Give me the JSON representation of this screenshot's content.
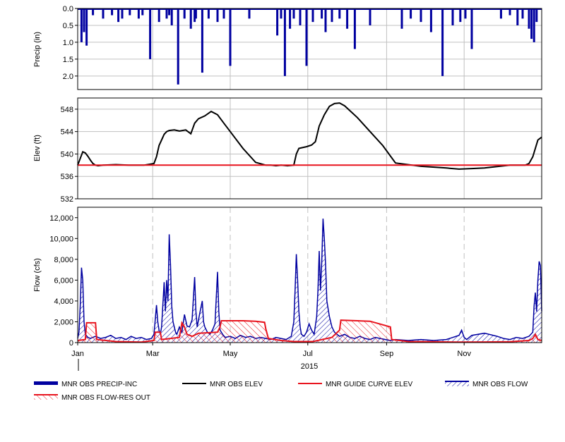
{
  "colors": {
    "precip": "#0000a0",
    "elev": "#000000",
    "guide": "#e8141e",
    "flow": "#0000a0",
    "release": "#e8141e",
    "grid": "#c0c0c0",
    "frame": "#000000"
  },
  "chart_data": [
    {
      "type": "bar",
      "ylabel": "Precip (in)",
      "ylim": [
        0,
        2.4
      ],
      "inverted_y": true,
      "grid": true,
      "y_ticks": [
        "0.0",
        "0.5",
        "1.0",
        "1.5",
        "2.0"
      ],
      "x_day_range": [
        0,
        365
      ],
      "series": [
        {
          "name": "MNR OBS PRECIP-INC",
          "color": "#0000a0",
          "day": [
            3,
            5,
            7,
            12,
            20,
            27,
            32,
            35,
            41,
            48,
            51,
            57,
            64,
            70,
            72,
            74,
            79,
            84,
            89,
            92,
            93,
            98,
            103,
            110,
            115,
            120,
            135,
            157,
            160,
            163,
            167,
            170,
            175,
            180,
            185,
            192,
            195,
            200,
            206,
            212,
            218,
            230,
            255,
            262,
            270,
            278,
            287,
            295,
            301,
            305,
            310,
            333,
            340,
            346,
            350,
            355,
            357,
            359,
            361
          ],
          "value": [
            1.0,
            0.7,
            1.1,
            0.2,
            0.3,
            0.2,
            0.4,
            0.3,
            0.2,
            0.3,
            0.2,
            1.5,
            0.4,
            0.3,
            0.2,
            0.5,
            2.25,
            0.3,
            0.6,
            0.4,
            0.3,
            1.9,
            0.3,
            0.4,
            0.3,
            1.7,
            0.3,
            0.8,
            0.3,
            2.0,
            0.6,
            0.3,
            0.5,
            1.7,
            0.4,
            0.3,
            0.7,
            0.4,
            0.3,
            0.6,
            1.2,
            0.5,
            0.6,
            0.3,
            0.4,
            0.7,
            2.0,
            0.5,
            0.4,
            0.3,
            1.2,
            0.3,
            0.2,
            0.5,
            0.3,
            0.6,
            0.9,
            1.0,
            0.4
          ]
        }
      ]
    },
    {
      "type": "line",
      "ylabel": "Elev (ft)",
      "ylim": [
        532,
        550
      ],
      "grid": true,
      "y_ticks": [
        "532",
        "536",
        "540",
        "544",
        "548"
      ],
      "y_tick_values": [
        532,
        536,
        540,
        544,
        548
      ],
      "x_day_range": [
        0,
        365
      ],
      "series": [
        {
          "name": "MNR OBS ELEV",
          "color": "#000000",
          "day": [
            0,
            2,
            4,
            6,
            8,
            10,
            12,
            14,
            16,
            20,
            30,
            40,
            52,
            60,
            62,
            64,
            66,
            68,
            70,
            72,
            76,
            80,
            85,
            89,
            92,
            95,
            100,
            105,
            110,
            115,
            120,
            130,
            140,
            148,
            152,
            156,
            160,
            165,
            170,
            172,
            174,
            178,
            180,
            184,
            187,
            190,
            194,
            198,
            202,
            206,
            210,
            220,
            230,
            240,
            250,
            270,
            290,
            300,
            310,
            320,
            340,
            352,
            355,
            358,
            360,
            362,
            365
          ],
          "value": [
            538.0,
            539.2,
            540.4,
            540.2,
            539.6,
            538.9,
            538.3,
            538.0,
            537.9,
            538.0,
            538.1,
            538.0,
            538.0,
            538.3,
            539.5,
            541.5,
            542.5,
            543.5,
            544.0,
            544.2,
            544.3,
            544.1,
            544.3,
            543.6,
            545.5,
            546.3,
            546.8,
            547.6,
            547.0,
            545.5,
            544.0,
            541.0,
            538.5,
            538.0,
            538.0,
            537.9,
            538.0,
            537.9,
            538.0,
            540.0,
            541.0,
            541.2,
            541.3,
            541.6,
            542.2,
            545.0,
            547.0,
            548.5,
            549.0,
            549.1,
            548.6,
            546.5,
            544.0,
            541.5,
            538.4,
            537.8,
            537.5,
            537.3,
            537.4,
            537.5,
            538.0,
            538.0,
            538.3,
            539.5,
            541.0,
            542.5,
            543.0
          ]
        },
        {
          "name": "MNR GUIDE CURVE ELEV",
          "color": "#e8141e",
          "day": [
            0,
            365
          ],
          "value": [
            538.0,
            538.0
          ]
        }
      ]
    },
    {
      "type": "area",
      "ylabel": "Flow (cfs)",
      "xlabel": "2015",
      "ylim": [
        0,
        13000
      ],
      "grid": true,
      "y_ticks": [
        "0",
        "2,000",
        "4,000",
        "6,000",
        "8,000",
        "10,000",
        "12,000"
      ],
      "y_tick_values": [
        0,
        2000,
        4000,
        6000,
        8000,
        10000,
        12000
      ],
      "x_ticks": [
        "Jan",
        "Mar",
        "May",
        "Jul",
        "Sep",
        "Nov"
      ],
      "x_tick_days": [
        0,
        59,
        120,
        181,
        243,
        304
      ],
      "x_day_range": [
        0,
        365
      ],
      "series": [
        {
          "name": "MNR OBS FLOW",
          "color": "#0000a0",
          "hatched": true,
          "day": [
            0,
            1,
            2,
            3,
            4,
            5,
            6,
            8,
            10,
            14,
            18,
            22,
            26,
            30,
            34,
            38,
            42,
            46,
            50,
            54,
            58,
            60,
            62,
            63,
            64,
            65,
            66,
            68,
            69,
            70,
            71,
            72,
            73,
            74,
            75,
            76,
            77,
            78,
            80,
            82,
            84,
            86,
            88,
            90,
            92,
            93,
            94,
            96,
            98,
            99,
            100,
            102,
            104,
            106,
            108,
            110,
            111,
            112,
            114,
            116,
            120,
            124,
            128,
            132,
            136,
            140,
            144,
            148,
            152,
            156,
            160,
            164,
            168,
            170,
            171,
            172,
            173,
            174,
            175,
            176,
            178,
            180,
            182,
            184,
            186,
            188,
            189,
            190,
            191,
            192,
            193,
            194,
            195,
            196,
            198,
            200,
            202,
            204,
            206,
            210,
            214,
            218,
            222,
            226,
            230,
            234,
            238,
            242,
            246,
            250,
            260,
            270,
            280,
            290,
            300,
            302,
            304,
            306,
            310,
            320,
            330,
            335,
            340,
            345,
            350,
            355,
            358,
            359,
            360,
            361,
            362,
            363,
            364,
            365
          ],
          "value": [
            400,
            1000,
            3500,
            7200,
            6000,
            2000,
            800,
            500,
            400,
            600,
            400,
            500,
            700,
            400,
            500,
            300,
            600,
            400,
            500,
            300,
            400,
            800,
            3600,
            2000,
            1200,
            800,
            1500,
            5800,
            3000,
            6000,
            4000,
            10400,
            7500,
            3500,
            2000,
            1500,
            1000,
            800,
            1500,
            1000,
            2700,
            1600,
            1500,
            2200,
            6300,
            3000,
            1500,
            2800,
            4000,
            2000,
            1500,
            1000,
            800,
            1200,
            1800,
            6800,
            3000,
            1200,
            800,
            500,
            600,
            400,
            700,
            500,
            600,
            400,
            500,
            400,
            300,
            500,
            400,
            300,
            600,
            2000,
            5000,
            8500,
            6000,
            3000,
            1500,
            800,
            600,
            1000,
            1800,
            1200,
            800,
            2500,
            5000,
            8800,
            5000,
            7800,
            11900,
            10000,
            7500,
            4000,
            2500,
            1500,
            1000,
            800,
            600,
            800,
            500,
            400,
            600,
            400,
            300,
            500,
            400,
            300,
            200,
            300,
            200,
            300,
            200,
            300,
            700,
            1200,
            500,
            300,
            700,
            900,
            600,
            400,
            300,
            500,
            400,
            600,
            1000,
            3500,
            4800,
            3000,
            6000,
            7800,
            7400,
            3000,
            500
          ]
        },
        {
          "name": "MNR OBS FLOW-RES OUT",
          "color": "#e8141e",
          "hatched": true,
          "day": [
            0,
            6,
            7,
            14,
            15,
            30,
            50,
            60,
            61,
            65,
            66,
            80,
            82,
            84,
            86,
            90,
            95,
            110,
            112,
            113,
            130,
            140,
            147,
            148,
            150,
            160,
            170,
            185,
            200,
            206,
            207,
            220,
            230,
            246,
            247,
            260,
            280,
            300,
            320,
            340,
            355,
            358,
            360,
            362,
            365
          ],
          "value": [
            200,
            300,
            1900,
            1900,
            300,
            100,
            50,
            200,
            1000,
            1000,
            300,
            500,
            1900,
            1500,
            800,
            600,
            900,
            1000,
            1500,
            2100,
            2100,
            2050,
            1950,
            1300,
            400,
            200,
            100,
            100,
            500,
            1200,
            2150,
            2100,
            2050,
            1500,
            300,
            100,
            80,
            50,
            60,
            80,
            200,
            400,
            800,
            300,
            200
          ]
        }
      ]
    }
  ],
  "legend": {
    "items": [
      {
        "label": "MNR OBS PRECIP-INC",
        "style": "thick-line",
        "color": "#0000a0"
      },
      {
        "label": "MNR OBS ELEV",
        "style": "line",
        "color": "#000000"
      },
      {
        "label": "MNR GUIDE CURVE ELEV",
        "style": "line",
        "color": "#e8141e"
      },
      {
        "label": "MNR OBS FLOW",
        "style": "hatch-blue",
        "color": "#0000a0"
      },
      {
        "label": "MNR OBS FLOW-RES OUT",
        "style": "hatch-red",
        "color": "#e8141e"
      }
    ]
  }
}
